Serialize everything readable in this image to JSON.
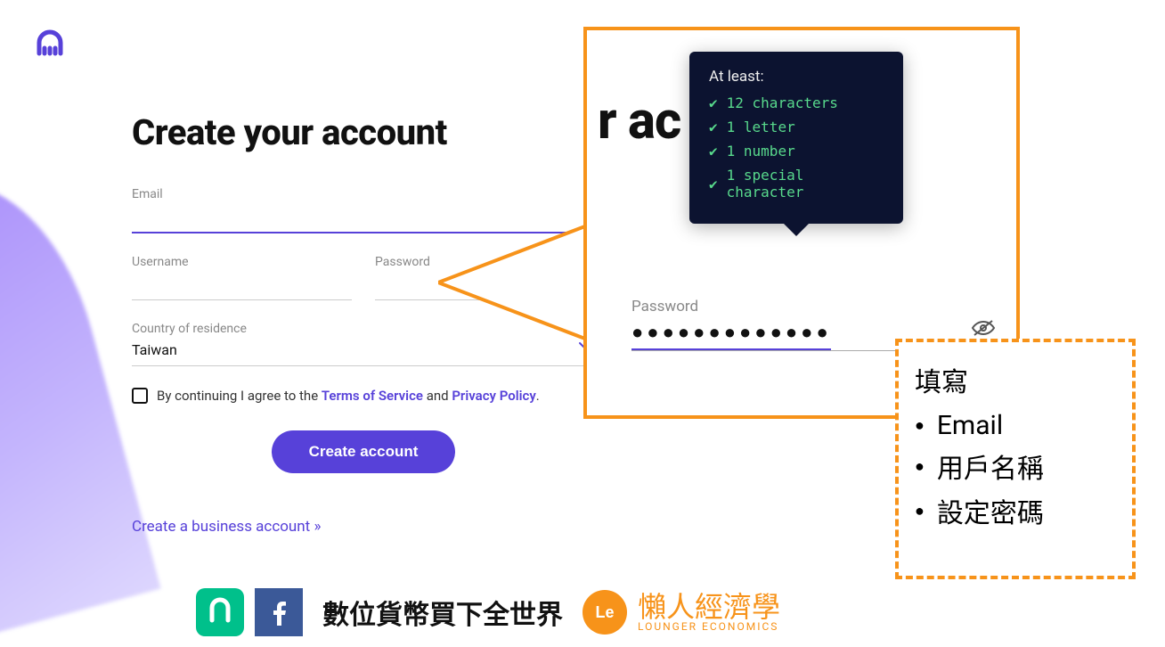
{
  "page_title": "Create your account",
  "logo_color": "#5741d9",
  "fields": {
    "email_label": "Email",
    "email_value": "",
    "username_label": "Username",
    "username_value": "",
    "password_label": "Password",
    "password_value": "",
    "country_label": "Country of residence",
    "country_value": "Taiwan"
  },
  "agree": {
    "prefix": "By continuing I agree to the ",
    "tos": "Terms of Service",
    "middle": " and ",
    "pp": "Privacy Policy",
    "suffix": "."
  },
  "create_button": "Create account",
  "business_link": "Create a business account »",
  "callout": {
    "partial_heading": "r ac",
    "tooltip_title": "At least:",
    "tooltip_items": [
      "12 characters",
      "1 letter",
      "1 number",
      "1 special character"
    ],
    "password_label": "Password",
    "password_masked": "●●●●●●●●●●●●●"
  },
  "dashed": {
    "heading": "填寫",
    "items": [
      "Email",
      "用戶名稱",
      "設定密碼"
    ]
  },
  "footer": {
    "text1": "數位貨幣買下全世界",
    "le_cn": "懶人經濟學",
    "le_en": "LOUNGER ECONOMICS"
  }
}
